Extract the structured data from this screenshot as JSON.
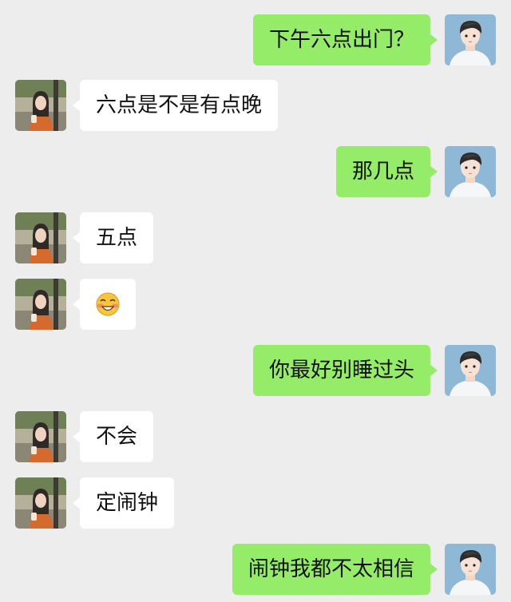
{
  "messages": [
    {
      "side": "right",
      "text": "下午六点出门？"
    },
    {
      "side": "left",
      "text": "六点是不是有点晚"
    },
    {
      "side": "right",
      "text": "那几点"
    },
    {
      "side": "left",
      "text": "五点"
    },
    {
      "side": "left",
      "text": "",
      "emoji": "flushed-grin-emoji"
    },
    {
      "side": "right",
      "text": "你最好别睡过头"
    },
    {
      "side": "left",
      "text": "不会"
    },
    {
      "side": "left",
      "text": "定闹钟"
    },
    {
      "side": "right",
      "text": "闹钟我都不太相信"
    }
  ],
  "colors": {
    "background": "#ededed",
    "incoming_bubble": "#ffffff",
    "outgoing_bubble": "#95ec69",
    "text": "#111111"
  }
}
